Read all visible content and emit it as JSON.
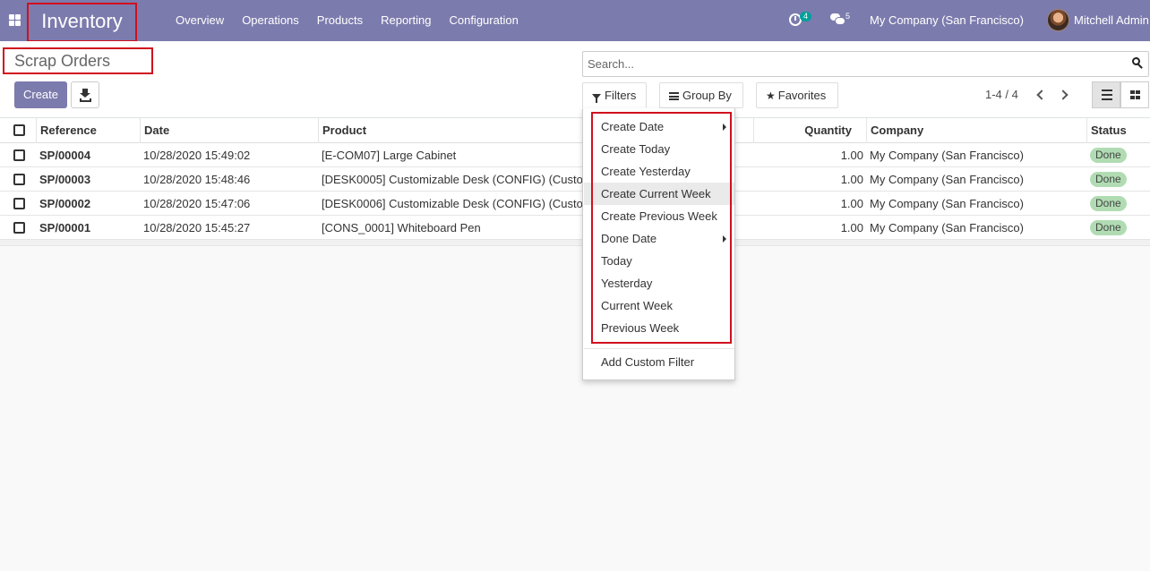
{
  "navbar": {
    "brand": "Inventory",
    "menu": [
      "Overview",
      "Operations",
      "Products",
      "Reporting",
      "Configuration"
    ],
    "activity_count": "4",
    "message_count": "5",
    "company": "My Company (San Francisco)",
    "user": "Mitchell Admin"
  },
  "control_panel": {
    "title": "Scrap Orders",
    "create_label": "Create",
    "search_placeholder": "Search...",
    "filters_label": "Filters",
    "group_by_label": "Group By",
    "favorites_label": "Favorites",
    "pager": "1-4 / 4"
  },
  "table": {
    "headers": {
      "reference": "Reference",
      "date": "Date",
      "product": "Product",
      "quantity": "Quantity",
      "company": "Company",
      "status": "Status"
    },
    "rows": [
      {
        "reference": "SP/00004",
        "date": "10/28/2020 15:49:02",
        "product": "[E-COM07] Large Cabinet",
        "quantity": "1.00",
        "company": "My Company (San Francisco)",
        "status": "Done"
      },
      {
        "reference": "SP/00003",
        "date": "10/28/2020 15:48:46",
        "product": "[DESK0005] Customizable Desk (CONFIG) (Custom, Black)",
        "quantity": "1.00",
        "company": "My Company (San Francisco)",
        "status": "Done"
      },
      {
        "reference": "SP/00002",
        "date": "10/28/2020 15:47:06",
        "product": "[DESK0006] Customizable Desk (CONFIG) (Custom, White)",
        "quantity": "1.00",
        "company": "My Company (San Francisco)",
        "status": "Done"
      },
      {
        "reference": "SP/00001",
        "date": "10/28/2020 15:45:27",
        "product": "[CONS_0001] Whiteboard Pen",
        "quantity": "1.00",
        "company": "My Company (San Francisco)",
        "status": "Done"
      }
    ]
  },
  "filters_dropdown": {
    "items": [
      {
        "label": "Create Date",
        "submenu": true
      },
      {
        "label": "Create Today",
        "submenu": false
      },
      {
        "label": "Create Yesterday",
        "submenu": false
      },
      {
        "label": "Create Current Week",
        "submenu": false
      },
      {
        "label": "Create Previous Week",
        "submenu": false
      },
      {
        "label": "Done Date",
        "submenu": true
      },
      {
        "label": "Today",
        "submenu": false
      },
      {
        "label": "Yesterday",
        "submenu": false
      },
      {
        "label": "Current Week",
        "submenu": false
      },
      {
        "label": "Previous Week",
        "submenu": false
      }
    ],
    "custom_filter_label": "Add Custom Filter"
  },
  "colors": {
    "brand": "#7c7bad",
    "highlight": "#d0101e",
    "done_badge": "#b1dcb3"
  }
}
